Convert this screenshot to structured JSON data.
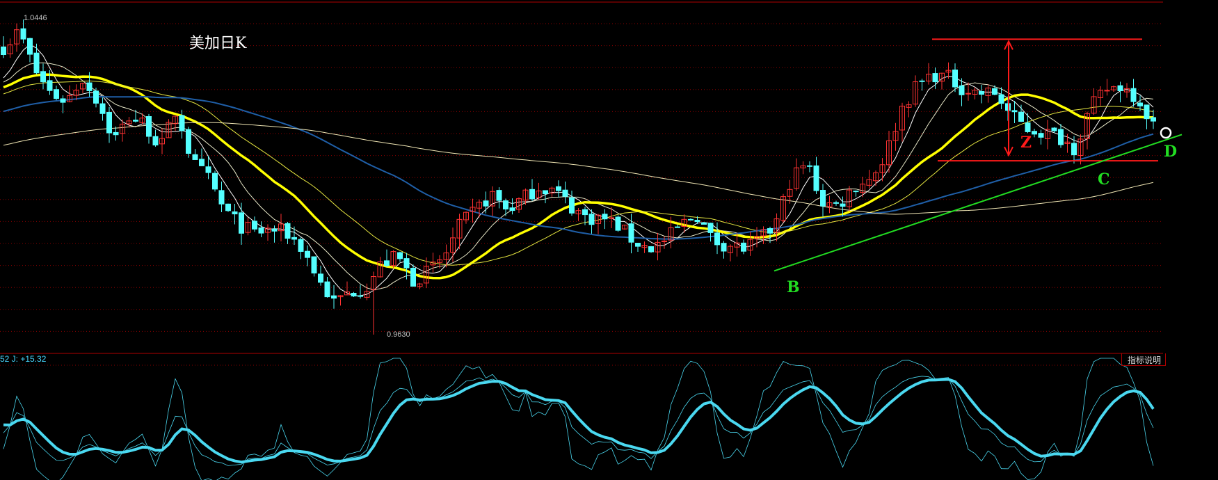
{
  "title": "美加日K",
  "indicator_label": "52 J: +15.32",
  "indicator_button": "指标说明",
  "colors": {
    "up": "#ff3232",
    "down": "#54ffff",
    "grid": "#8b0000",
    "ma5": "#ffffff",
    "ma10": "#e8e8c8",
    "ma20": "#ffff00",
    "ma30": "#e6e640",
    "ma60": "#1f5fa8",
    "ma120": "#f0e6b4",
    "kdj": "#4ad8f0",
    "annotation_red": "#ff1a1a",
    "annotation_green": "#22dd22"
  },
  "chart_data": {
    "type": "candlestick",
    "title": "美加日K",
    "candle_count": 175,
    "price_range": [
      0.963,
      1.0446
    ],
    "max_label": "1.0446",
    "min_label": "0.9630",
    "close_path_keypoints": [
      1.0375,
      1.0416,
      1.0315,
      1.0255,
      1.0235,
      1.0295,
      1.0235,
      1.0134,
      1.0195,
      1.0174,
      1.0114,
      1.0215,
      1.0074,
      1.0034,
      0.9953,
      0.9913,
      0.9893,
      0.9903,
      0.9893,
      0.9853,
      0.9772,
      0.9712,
      0.9742,
      0.9752,
      0.9813,
      0.9833,
      0.9772,
      0.9793,
      0.9833,
      0.9913,
      0.9953,
      0.9994,
      0.9953,
      0.9983,
      1.0014,
      1.0004,
      0.9963,
      0.9933,
      0.9933,
      0.9913,
      0.9873,
      0.9853,
      0.9873,
      0.9913,
      0.9943,
      0.9873,
      0.9863,
      0.9853,
      0.9873,
      0.9913,
      1.0034,
      1.0074,
      0.9973,
      0.9963,
      1.0014,
      1.0034,
      1.0094,
      1.0215,
      1.0275,
      1.0305,
      1.0295,
      1.0265,
      1.0255,
      1.0255,
      1.0195,
      1.0164,
      1.0154,
      1.0144,
      1.0114,
      1.0215,
      1.0265,
      1.0275,
      1.0245,
      1.0174
    ],
    "moving_averages": [
      5,
      10,
      20,
      30,
      60,
      120
    ],
    "indicator": {
      "name": "KDJ",
      "J": 15.32,
      "range": [
        0,
        100
      ]
    },
    "annotations": {
      "resistance_level": 1.0395,
      "support_level": 1.008,
      "trendline": {
        "from_index": 117,
        "from_price": 0.9795,
        "to_index": 178,
        "to_price": 1.0148
      },
      "labels": {
        "B": "B",
        "C": "C",
        "D": "D",
        "Z": "Z"
      }
    }
  }
}
